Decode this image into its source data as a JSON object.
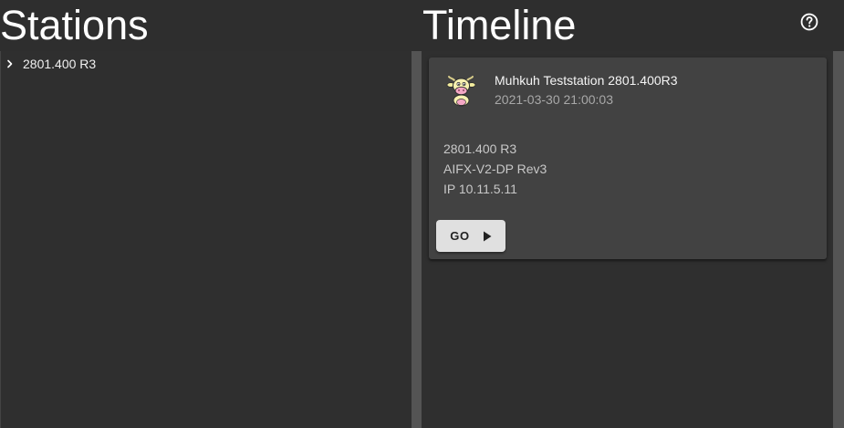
{
  "headers": {
    "stations_title": "Stations",
    "timeline_title": "Timeline",
    "help_icon": "help-circle-icon"
  },
  "stations": {
    "items": [
      {
        "label": "2801.400 R3",
        "icon": "chevron-right-icon"
      }
    ]
  },
  "timeline": {
    "cards": [
      {
        "avatar_icon": "cow-avatar-icon",
        "title": "Muhkuh Teststation 2801.400R3",
        "subtitle": "2021-03-30 21:00:03",
        "lines": [
          "2801.400 R3",
          "AIFX-V2-DP Rev3",
          "IP 10.11.5.11"
        ],
        "button_label": "GO",
        "button_icon": "play-icon"
      }
    ]
  },
  "colors": {
    "background": "#2d2d2d",
    "card": "#424242",
    "scrollbar": "#545454",
    "button": "#e0e0e0",
    "subtitle_text": "#a8a8a8"
  }
}
